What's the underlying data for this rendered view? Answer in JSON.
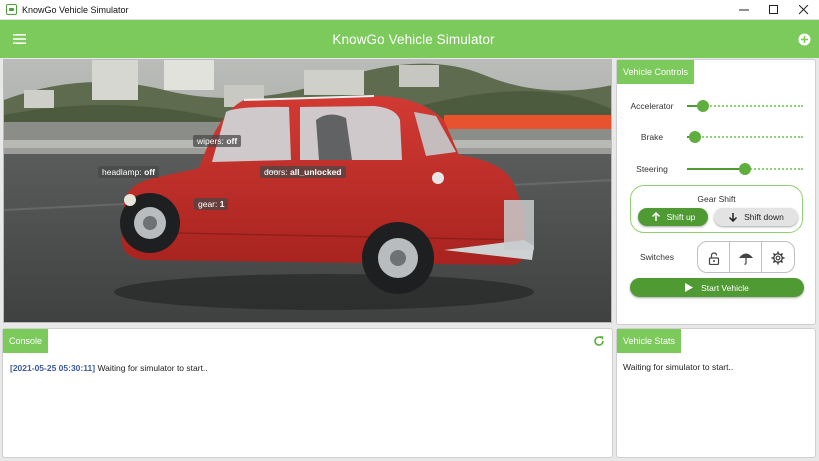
{
  "window": {
    "title": "KnowGo Vehicle Simulator",
    "minimize_icon": "minimize-icon",
    "maximize_icon": "maximize-icon",
    "close_icon": "close-icon"
  },
  "appbar": {
    "title": "KnowGo Vehicle Simulator",
    "menu_icon": "hamburger-menu-icon",
    "action_icon": "add-circle-icon"
  },
  "scene": {
    "overlays": {
      "wipers": {
        "label": "wipers:",
        "value": "off"
      },
      "headlamp": {
        "label": "headlamp:",
        "value": "off"
      },
      "doors": {
        "label": "doors:",
        "value": "all_unlocked"
      },
      "gear": {
        "label": "gear:",
        "value": "1"
      }
    }
  },
  "controls": {
    "title": "Vehicle Controls",
    "accelerator": {
      "label": "Accelerator",
      "level": 0.08
    },
    "brake": {
      "label": "Brake",
      "level": 0.0
    },
    "steering": {
      "label": "Steering",
      "level": 0.5
    },
    "gear_shift": {
      "title": "Gear Shift",
      "shift_up": "Shift up",
      "shift_down": "Shift down"
    },
    "switches": {
      "label": "Switches",
      "icons": [
        "lock-icon",
        "umbrella-icon",
        "gear-icon"
      ]
    },
    "start_button": "Start Vehicle"
  },
  "console": {
    "title": "Console",
    "refresh_icon": "refresh-icon",
    "log": [
      {
        "timestamp": "[2021-05-25 05:30:11]",
        "message": "Waiting for simulator to start.."
      }
    ]
  },
  "stats": {
    "title": "Vehicle Stats",
    "message": "Waiting for simulator to start.."
  },
  "colors": {
    "accent": "#7cc95c",
    "accent_dark": "#4f9a33",
    "timestamp": "#3d5a9b"
  }
}
